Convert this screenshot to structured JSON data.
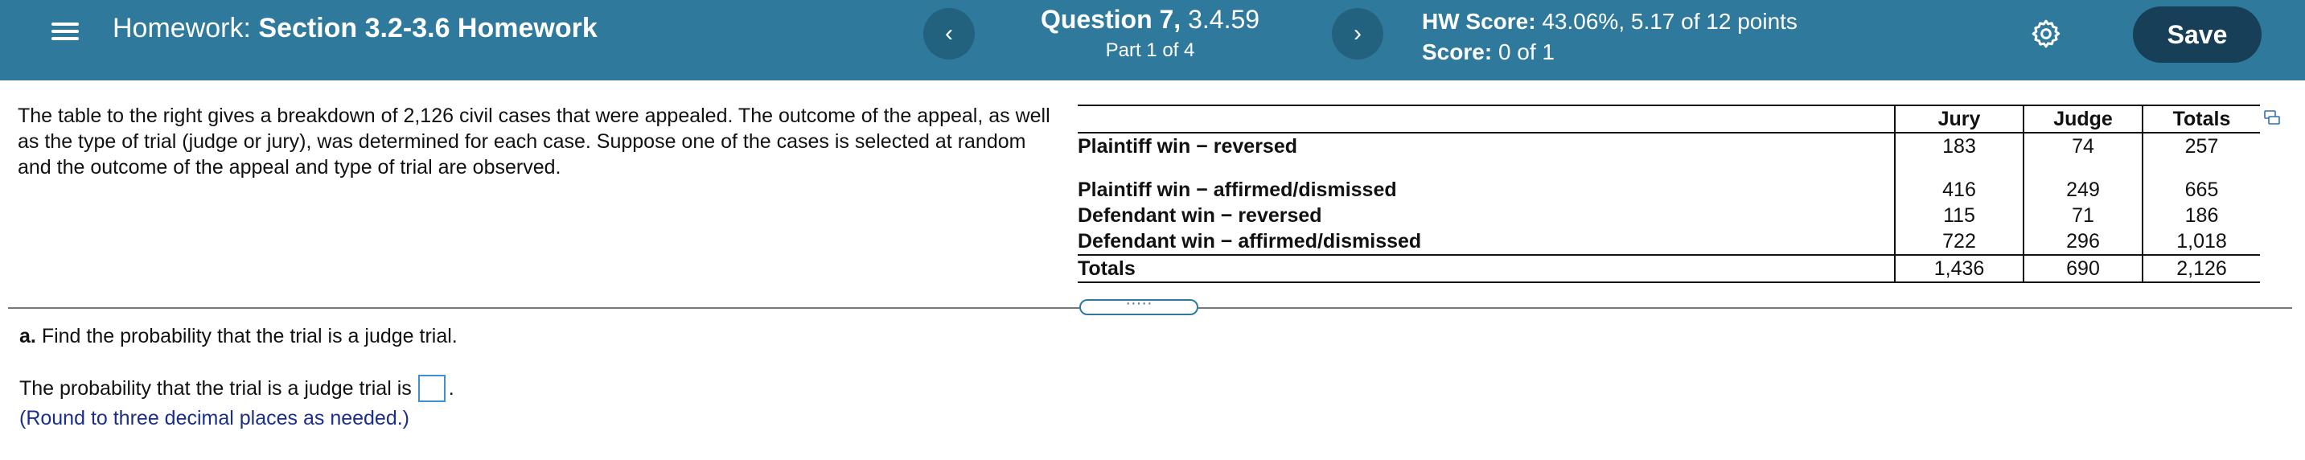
{
  "header": {
    "title_prefix": "Homework:",
    "title_name": "Section 3.2-3.6 Homework",
    "prev_label": "‹",
    "next_label": "›",
    "question_label": "Question 7,",
    "question_id": "3.4.59",
    "part_label": "Part 1 of 4",
    "hw_score_label": "HW Score:",
    "hw_score_value": "43.06%, 5.17 of 12 points",
    "score_label": "Score:",
    "score_value": "0 of 1",
    "save_label": "Save",
    "icons": {
      "menu": "menu-icon",
      "settings": "gear-icon"
    },
    "colors": {
      "header_bg": "#2f7a9c",
      "nav_button_bg": "#23627e",
      "save_bg": "#173f57"
    }
  },
  "problem": {
    "text": "The table to the right gives a breakdown of 2,126 civil cases that were appealed. The outcome of the appeal, as well as the type of trial (judge or jury), was determined for each case. Suppose one of the cases is selected at random and the outcome of the appeal and type of trial are observed."
  },
  "table": {
    "columns": [
      "Jury",
      "Judge",
      "Totals"
    ],
    "rows": [
      {
        "label": "Plaintiff win − reversed",
        "values": [
          "183",
          "74",
          "257"
        ]
      },
      {
        "label": "Plaintiff win − affirmed/dismissed",
        "values": [
          "416",
          "249",
          "665"
        ]
      },
      {
        "label": "Defendant win − reversed",
        "values": [
          "115",
          "71",
          "186"
        ]
      },
      {
        "label": "Defendant win − affirmed/dismissed",
        "values": [
          "722",
          "296",
          "1,018"
        ]
      }
    ],
    "totals": {
      "label": "Totals",
      "values": [
        "1,436",
        "690",
        "2,126"
      ]
    }
  },
  "drag_handle_label": "·····",
  "part_a": {
    "letter": "a.",
    "question": "Find the probability that the trial is a judge trial.",
    "answer_prefix": "The probability that the trial is a judge trial is",
    "answer_suffix": ".",
    "answer_value": "",
    "round_note": "(Round to three decimal places as needed.)"
  }
}
